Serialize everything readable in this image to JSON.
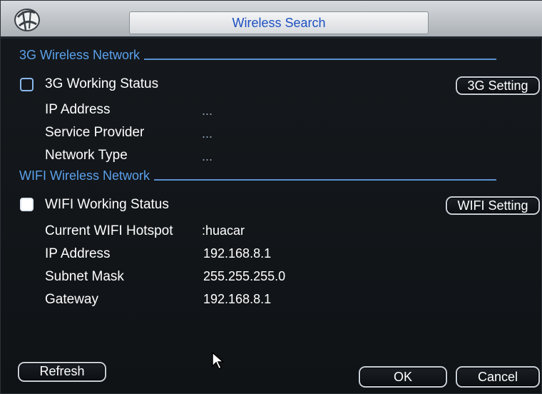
{
  "window": {
    "title": "Wireless Search"
  },
  "g3": {
    "section_label": "3G Wireless Network",
    "status_label": "3G Working Status",
    "status_checked": false,
    "setting_button": "3G Setting",
    "fields": [
      {
        "label": "IP Address",
        "value": "..."
      },
      {
        "label": "Service Provider",
        "value": "..."
      },
      {
        "label": "Network Type",
        "value": "..."
      }
    ]
  },
  "wifi": {
    "section_label": "WIFI Wireless Network",
    "status_label": "WIFI Working Status",
    "status_checked": true,
    "setting_button": "WIFI Setting",
    "fields": [
      {
        "label": "Current WIFI Hotspot",
        "value": ":huacar"
      },
      {
        "label": "IP Address",
        "value": "192.168.8.1"
      },
      {
        "label": "Subnet Mask",
        "value": "255.255.255.0"
      },
      {
        "label": "Gateway",
        "value": "192.168.8.1"
      }
    ]
  },
  "buttons": {
    "refresh": "Refresh",
    "ok": "OK",
    "cancel": "Cancel"
  }
}
